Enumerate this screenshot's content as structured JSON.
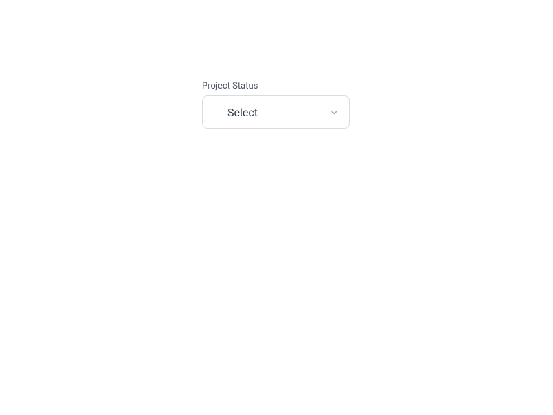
{
  "dropdown": {
    "label": "Project Status",
    "selected_value": "Select"
  }
}
